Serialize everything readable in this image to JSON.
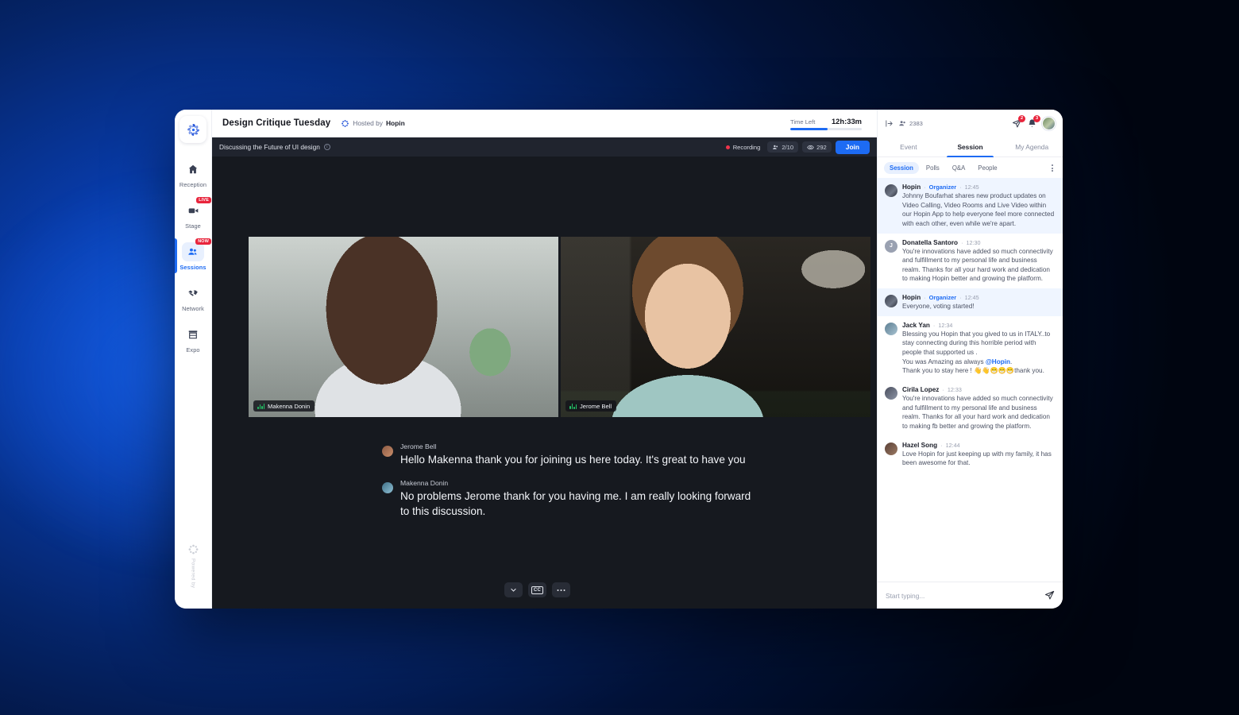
{
  "window": {
    "event_title": "Design Critique Tuesday",
    "hosted_label": "Hosted by",
    "hosted_name": "Hopin",
    "time_left_label": "Time Left",
    "time_left_value": "12h:33m",
    "time_left_percent": 52,
    "accent_color": "#1d6bf3",
    "recording_color": "#f0344b"
  },
  "rail": {
    "items": [
      {
        "label": "Reception",
        "icon": "home-icon",
        "badge": "",
        "active": false
      },
      {
        "label": "Stage",
        "icon": "video-camera-icon",
        "badge": "LIVE",
        "active": false
      },
      {
        "label": "Sessions",
        "icon": "people-group-icon",
        "badge": "NOW",
        "active": true
      },
      {
        "label": "Network",
        "icon": "handshake-icon",
        "badge": "",
        "active": false
      },
      {
        "label": "Expo",
        "icon": "booth-icon",
        "badge": "",
        "active": false
      }
    ],
    "powered_by": "Powered by"
  },
  "session_bar": {
    "session_name": "Discussing the Future of UI design",
    "recording_label": "Recording",
    "seats": "2/10",
    "viewers": "292",
    "join_label": "Join"
  },
  "stage": {
    "tiles": [
      {
        "name": "Makenna Donin",
        "speaking": true
      },
      {
        "name": "Jerome Bell",
        "speaking": true
      }
    ],
    "captions": [
      {
        "speaker": "Jerome Bell",
        "text": "Hello Makenna thank you for joining us here today. It's great to have you"
      },
      {
        "speaker": "Makenna Donin",
        "text": "No problems Jerome thank for you having me. I am really looking forward to this discussion."
      }
    ],
    "controls": [
      {
        "name": "collapse-captions-button",
        "glyph": "chevron-down-icon"
      },
      {
        "name": "closed-captions-button",
        "glyph": "cc-icon",
        "label": "CC"
      },
      {
        "name": "more-options-button",
        "glyph": "ellipsis-icon"
      }
    ]
  },
  "panel": {
    "collapse_icon": "collapse-panel-icon",
    "attendee_count": "2383",
    "notifications": [
      {
        "name": "share-icon",
        "badge": "2"
      },
      {
        "name": "bell-icon",
        "badge": "3"
      }
    ],
    "tabs": [
      {
        "label": "Event",
        "active": false
      },
      {
        "label": "Session",
        "active": true
      },
      {
        "label": "My Agenda",
        "active": false
      }
    ],
    "subtabs": [
      {
        "label": "Session",
        "active": true
      },
      {
        "label": "Polls",
        "active": false
      },
      {
        "label": "Q&A",
        "active": false
      },
      {
        "label": "People",
        "active": false
      }
    ],
    "messages": [
      {
        "author": "Hopin",
        "role": "Organizer",
        "time": "12:45",
        "text": "Johnny Boufarhat shares new product updates on Video Calling, Video Rooms and Live Video within our Hopin App to help everyone feel more connected with each other, even while we're apart.",
        "highlight": true,
        "avatar": "av-hopin",
        "initial": ""
      },
      {
        "author": "Donatella Santoro",
        "role": "",
        "time": "12:30",
        "text": "You're innovations have added so much connectivity and fulfillment to my personal life and business realm. Thanks for all your hard work and dedication to making Hopin better and growing the platform.",
        "highlight": false,
        "avatar": "av-donatella",
        "initial": "J"
      },
      {
        "author": "Hopin",
        "role": "Organizer",
        "time": "12:45",
        "text": "Everyone, voting started!",
        "highlight": true,
        "avatar": "av-hopin",
        "initial": ""
      },
      {
        "author": "Jack Yan",
        "role": "",
        "time": "12:34",
        "text": "Blessing you Hopin that you gived to us in ITALY..to stay connecting during this horrible period with people that supported us .",
        "text_line2": "You was Amazing as always ",
        "mention": "@Hopin",
        "text_line2_end": ".",
        "text_line3": "Thank you to stay here ! 👋👋😁😁😁thank you.",
        "highlight": false,
        "avatar": "av-jack",
        "initial": ""
      },
      {
        "author": "Cirila Lopez",
        "role": "",
        "time": "12:33",
        "text": "You're innovations have added so much connectivity and fulfillment to my personal life and business realm. Thanks for all your hard work and dedication to making fb better and growing the platform.",
        "highlight": false,
        "avatar": "av-cirila",
        "initial": ""
      },
      {
        "author": "Hazel Song",
        "role": "",
        "time": "12:44",
        "text": "Love Hopin for just keeping up with my family, it has been awesome for that.",
        "highlight": false,
        "avatar": "av-hazel",
        "initial": ""
      }
    ],
    "composer_placeholder": "Start typing...",
    "send_icon": "send-icon"
  }
}
